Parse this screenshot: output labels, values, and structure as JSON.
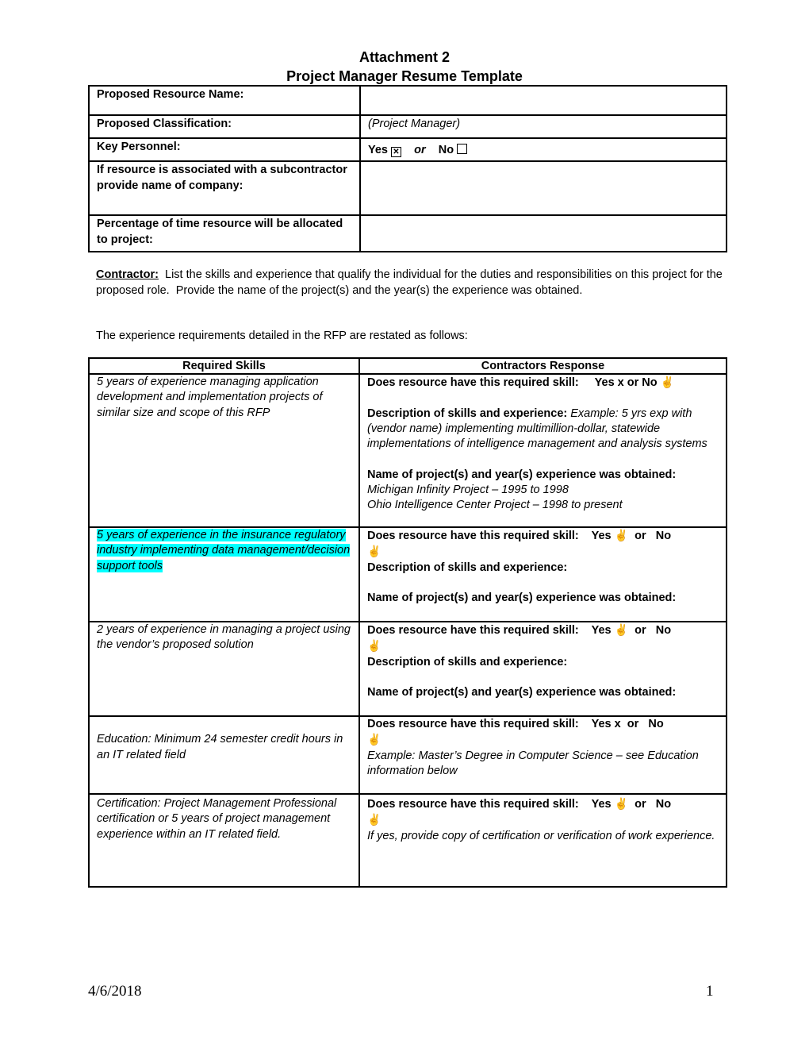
{
  "header": {
    "line1": "Attachment 2",
    "line2": "Project Manager Resume Template"
  },
  "info_table": {
    "rows": [
      {
        "label": "Proposed Resource Name:",
        "value": ""
      },
      {
        "label": "Proposed Classification:",
        "value": "(Project Manager)"
      },
      {
        "label": "Key Personnel:",
        "yes": "Yes",
        "or": "or",
        "no": "No",
        "yes_checked": true,
        "no_checked": false
      },
      {
        "label": "If resource is associated with a subcontractor provide name of company:",
        "value": ""
      },
      {
        "label": "Percentage of  time resource will be allocated to project:",
        "value": ""
      }
    ]
  },
  "instructions": {
    "contractor_label": "Contractor:",
    "contractor_text": "  List the skills and experience that qualify the individual for the duties and responsibilities on this project for the proposed role.  Provide the name of the project(s) and the year(s) the experience was obtained.",
    "restated": "The experience requirements detailed in the RFP are restated as follows:"
  },
  "skills_table": {
    "headers": [
      "Required Skills",
      "Contractors Response"
    ],
    "question": "Does resource have this required skill:",
    "desc_label": "Description of skills and experience:",
    "project_label": "Name of project(s) and year(s) experience was obtained:",
    "dove_icon": "✌",
    "rows": [
      {
        "skill": "5 years of experience managing application development and implementation projects of similar size and scope of this RFP",
        "answer": "Yes x or  No",
        "desc_example": " Example: 5 yrs exp with (vendor name) implementing multimillion-dollar, statewide implementations of intelligence management and analysis systems",
        "projects": [
          "Michigan Infinity Project – 1995 to 1998",
          "Ohio Intelligence Center Project – 1998 to present"
        ]
      },
      {
        "skill": "5 years of experience in the insurance regulatory industry implementing data management/decision support tools",
        "highlighted": true,
        "yes": "Yes",
        "or": "or   No"
      },
      {
        "skill": "2 years of experience in managing a project using the vendor’s proposed solution",
        "yes": "Yes",
        "or": "or   No"
      },
      {
        "skill": "Education: Minimum 24 semester credit hours in an IT related field",
        "answer": "Yes x  or   No",
        "note": "Example: Master’s Degree in Computer Science – see Education information below"
      },
      {
        "skill": "Certification: Project Management Professional certification or 5 years of project management experience within an IT related field.",
        "yes": "Yes",
        "or": "or   No",
        "note": "If yes, provide copy of certification or verification of work experience."
      }
    ]
  },
  "footer": {
    "date": "4/6/2018",
    "page": "1"
  }
}
